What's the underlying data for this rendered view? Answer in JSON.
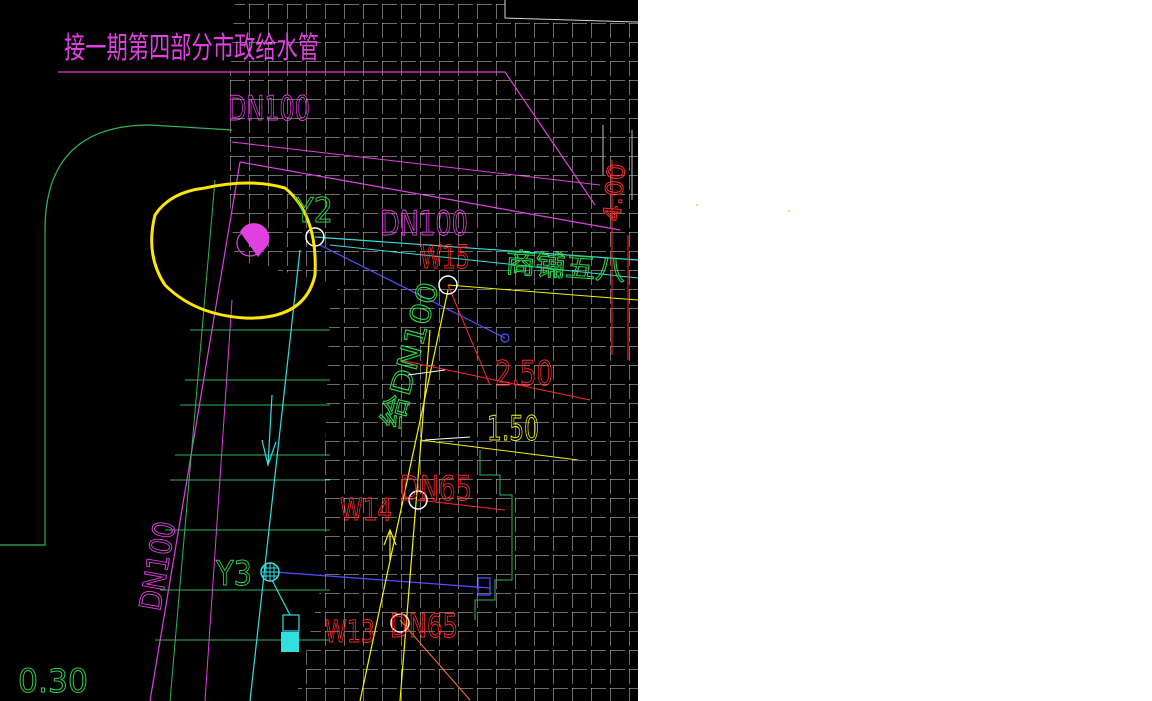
{
  "title": "接一期第四部分市政给水管",
  "labels": {
    "dn100_top": "DN100",
    "y2": "Y2",
    "dn100_mid": "DN100",
    "w15": "W15",
    "road_text": "商铺五八",
    "val_250": "2.50",
    "val_150": "1.50",
    "dn100_vertical": "给DN100",
    "dn100_left": "DN100",
    "y3": "Y3",
    "w14": "W14",
    "dn65_a": "DN65",
    "w13": "W13",
    "dn65_b": "DN65",
    "right_vertical": "4.00",
    "bottom_left": "0.30"
  },
  "colors": {
    "background": "#000000",
    "grid": "#d8d8d8",
    "title_magenta": "#e040e0",
    "label_red": "#ff2828",
    "label_green": "#2fd24a",
    "label_yellow": "#f4f400",
    "pipe_cyan": "#33e0e0",
    "highlight_circle": "#ffe600",
    "outline_green": "#2fb55a",
    "pipe_blue": "#5a4cff"
  }
}
